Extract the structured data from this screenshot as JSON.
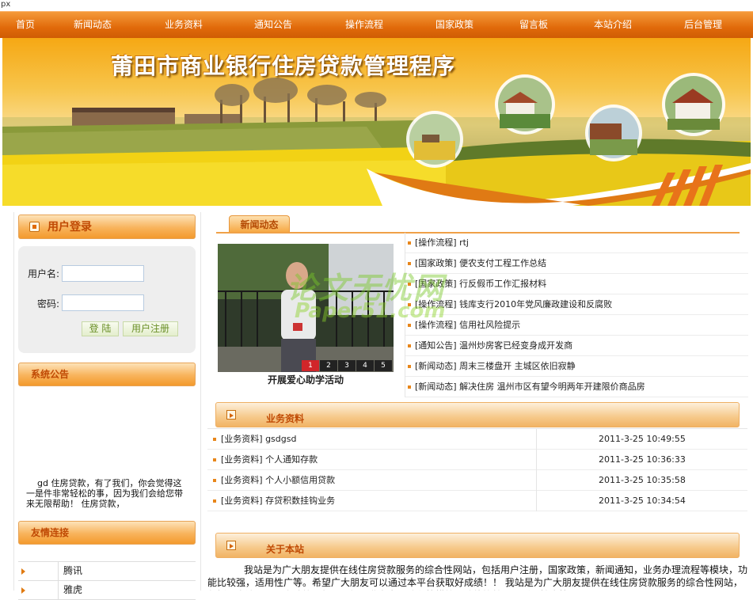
{
  "top_text": "px",
  "nav": {
    "items": [
      "首页",
      "新闻动态",
      "业务资料",
      "通知公告",
      "操作流程",
      "国家政策",
      "留言板",
      "本站介绍",
      "后台管理"
    ]
  },
  "banner": {
    "title": "莆田市商业银行住房贷款管理程序"
  },
  "login": {
    "heading": "用户登录",
    "username_label": "用户名:",
    "password_label": "密码:",
    "username_value": "",
    "password_value": "",
    "login_button": "登 陆",
    "register_button": "用户注册"
  },
  "notice": {
    "heading": "系统公告",
    "text": "gd 住房贷款，有了我们，你会觉得这一是件非常轻松的事，因为我们会给您带来无限帮助！ 住房贷款，"
  },
  "friend_links": {
    "heading": "友情连接",
    "items": [
      "腾讯",
      "雅虎"
    ]
  },
  "news": {
    "tab": "新闻动态",
    "photo_caption": "开展爱心助学活动",
    "photo_pages": [
      "1",
      "2",
      "3",
      "4",
      "5"
    ],
    "active_page": "1",
    "items": [
      "[操作流程] rtj",
      "[国家政策] 便农支付工程工作总结",
      "[国家政策] 行反假币工作汇报材料",
      "[操作流程] 钱库支行2010年党风廉政建设和反腐败",
      "[操作流程] 信用社风险提示",
      "[通知公告] 温州炒房客已经变身成开发商",
      "[新闻动态] 周末三楼盘开 主城区依旧寂静",
      "[新闻动态] 解决住房 温州市区有望今明两年开建限价商品房"
    ]
  },
  "watermark": {
    "line1": "论文无忧网",
    "line2": "Paper51.com"
  },
  "business": {
    "heading": "业务资料",
    "rows": [
      {
        "title": "[业务资料] gsdgsd",
        "date": "2011-3-25 10:49:55"
      },
      {
        "title": "[业务资料] 个人通知存款",
        "date": "2011-3-25 10:36:33"
      },
      {
        "title": "[业务资料] 个人小额信用贷款",
        "date": "2011-3-25 10:35:58"
      },
      {
        "title": "[业务资料] 存贷积数挂钩业务",
        "date": "2011-3-25 10:34:54"
      }
    ]
  },
  "about": {
    "heading": "关于本站",
    "text": "我站是为广大朋友提供在线住房贷款服务的综合性网站，包括用户注册，国家政策，新闻通知，业务办理流程等模块，功能比较强，适用性广等。希望广大朋友可以通过本平台获取好成绩！！ 我站是为广大朋友提供在线住房贷款服务的综合性网站，包括用户注册，国家政策，新闻通知，业务办理流程等模块，功能比较强，适用性广等。"
  },
  "colors": {
    "nav_orange": "#e16a0a",
    "heading_text": "#c04a04"
  }
}
